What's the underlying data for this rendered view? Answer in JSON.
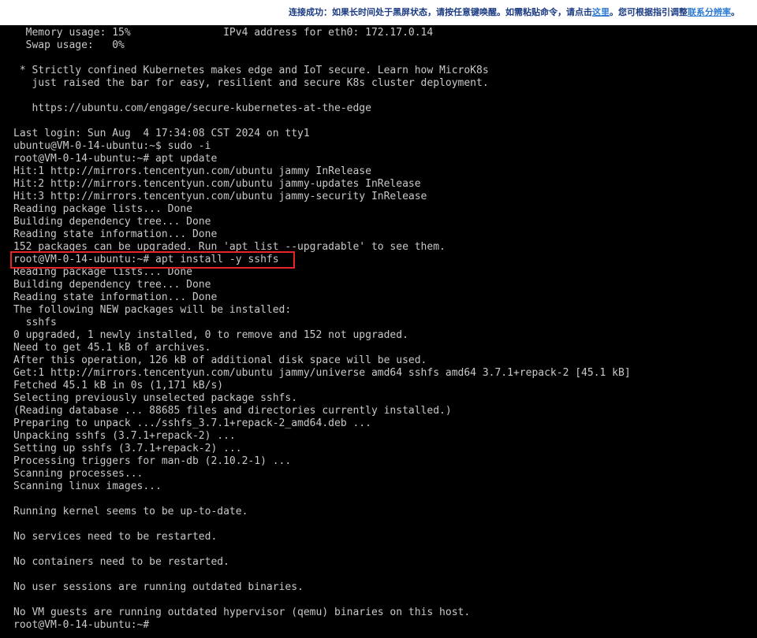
{
  "banner": {
    "text_before": "连接成功：如果长时间处于黑屏状态，请按任意键唤醒。如需粘贴命令，请点击",
    "link_here": "这里",
    "text_middle": "。您可根据指引调整",
    "link_guide": "联系分辨率",
    "text_after": "。"
  },
  "terminal": {
    "lines": [
      "  Memory usage: 15%               IPv4 address for eth0: 172.17.0.14",
      "  Swap usage:   0%",
      "",
      " * Strictly confined Kubernetes makes edge and IoT secure. Learn how MicroK8s",
      "   just raised the bar for easy, resilient and secure K8s cluster deployment.",
      "",
      "   https://ubuntu.com/engage/secure-kubernetes-at-the-edge",
      "",
      "Last login: Sun Aug  4 17:34:08 CST 2024 on tty1",
      "ubuntu@VM-0-14-ubuntu:~$ sudo -i",
      "root@VM-0-14-ubuntu:~# apt update",
      "Hit:1 http://mirrors.tencentyun.com/ubuntu jammy InRelease",
      "Hit:2 http://mirrors.tencentyun.com/ubuntu jammy-updates InRelease",
      "Hit:3 http://mirrors.tencentyun.com/ubuntu jammy-security InRelease",
      "Reading package lists... Done",
      "Building dependency tree... Done",
      "Reading state information... Done",
      "152 packages can be upgraded. Run 'apt list --upgradable' to see them.",
      "root@VM-0-14-ubuntu:~# apt install -y sshfs",
      "Reading package lists... Done",
      "Building dependency tree... Done",
      "Reading state information... Done",
      "The following NEW packages will be installed:",
      "  sshfs",
      "0 upgraded, 1 newly installed, 0 to remove and 152 not upgraded.",
      "Need to get 45.1 kB of archives.",
      "After this operation, 126 kB of additional disk space will be used.",
      "Get:1 http://mirrors.tencentyun.com/ubuntu jammy/universe amd64 sshfs amd64 3.7.1+repack-2 [45.1 kB]",
      "Fetched 45.1 kB in 0s (1,171 kB/s)",
      "Selecting previously unselected package sshfs.",
      "(Reading database ... 88685 files and directories currently installed.)",
      "Preparing to unpack .../sshfs_3.7.1+repack-2_amd64.deb ...",
      "Unpacking sshfs (3.7.1+repack-2) ...",
      "Setting up sshfs (3.7.1+repack-2) ...",
      "Processing triggers for man-db (2.10.2-1) ...",
      "Scanning processes...",
      "Scanning linux images...",
      "",
      "Running kernel seems to be up-to-date.",
      "",
      "No services need to be restarted.",
      "",
      "No containers need to be restarted.",
      "",
      "No user sessions are running outdated binaries.",
      "",
      "No VM guests are running outdated hypervisor (qemu) binaries on this host.",
      "root@VM-0-14-ubuntu:~# "
    ]
  },
  "colors": {
    "terminal_background": "#000000",
    "terminal_text": "#c9c9c9",
    "banner_background": "#ffffff",
    "banner_text": "#1a3a82",
    "banner_link": "#2e7bd6",
    "highlight_border": "#e8242a"
  }
}
